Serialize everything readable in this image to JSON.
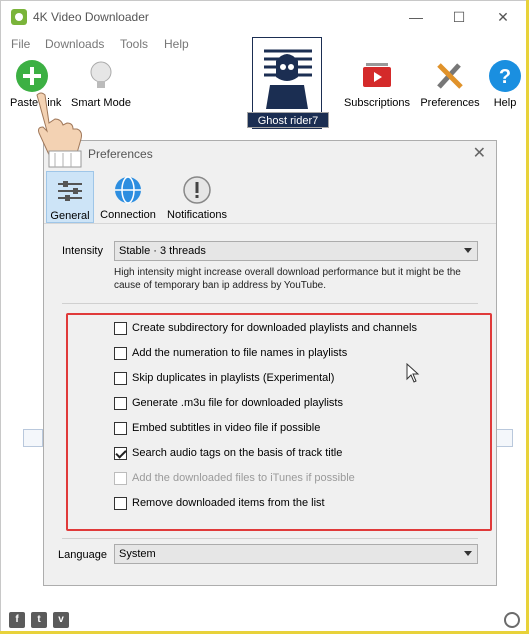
{
  "window": {
    "title": "4K Video Downloader",
    "controls": [
      "minimize",
      "maximize",
      "close"
    ]
  },
  "menu": [
    "File",
    "Downloads",
    "Tools",
    "Help"
  ],
  "toolbar": {
    "paste_label": "Paste Link",
    "smart_mode_label": "Smart Mode",
    "subscriptions_label": "Subscriptions",
    "preferences_label": "Preferences",
    "help_label": "Help"
  },
  "avatar": {
    "caption": "Ghost rider7"
  },
  "dialog": {
    "title": "Preferences",
    "tabs": [
      {
        "label": "General",
        "icon": "sliders-icon",
        "active": true
      },
      {
        "label": "Connection",
        "icon": "globe-icon",
        "active": false
      },
      {
        "label": "Notifications",
        "icon": "exclamation-icon",
        "active": false
      }
    ],
    "intensity": {
      "label": "Intensity",
      "value": "Stable · 3 threads",
      "description": "High intensity might increase overall download performance but it might be the cause of temporary ban ip address by YouTube."
    },
    "options": [
      {
        "label": "Create subdirectory for downloaded playlists and channels",
        "checked": false,
        "disabled": false
      },
      {
        "label": "Add the numeration to file names in playlists",
        "checked": false,
        "disabled": false
      },
      {
        "label": "Skip duplicates in playlists (Experimental)",
        "checked": false,
        "disabled": false
      },
      {
        "label": "Generate .m3u file for downloaded playlists",
        "checked": false,
        "disabled": false
      },
      {
        "label": "Embed subtitles in video file if possible",
        "checked": false,
        "disabled": false
      },
      {
        "label": "Search audio tags on the basis of track title",
        "checked": true,
        "disabled": false
      },
      {
        "label": "Add the downloaded files to iTunes if possible",
        "checked": false,
        "disabled": true
      },
      {
        "label": "Remove downloaded items from the list",
        "checked": false,
        "disabled": false
      }
    ],
    "language": {
      "label": "Language",
      "value": "System"
    }
  },
  "footer": {
    "social": [
      "f",
      "t",
      "v"
    ]
  },
  "colors": {
    "highlight_box": "#e03a3a",
    "active_tab": "#cde4f7",
    "paste_green": "#3cb043",
    "help_blue": "#1a8fe0"
  }
}
